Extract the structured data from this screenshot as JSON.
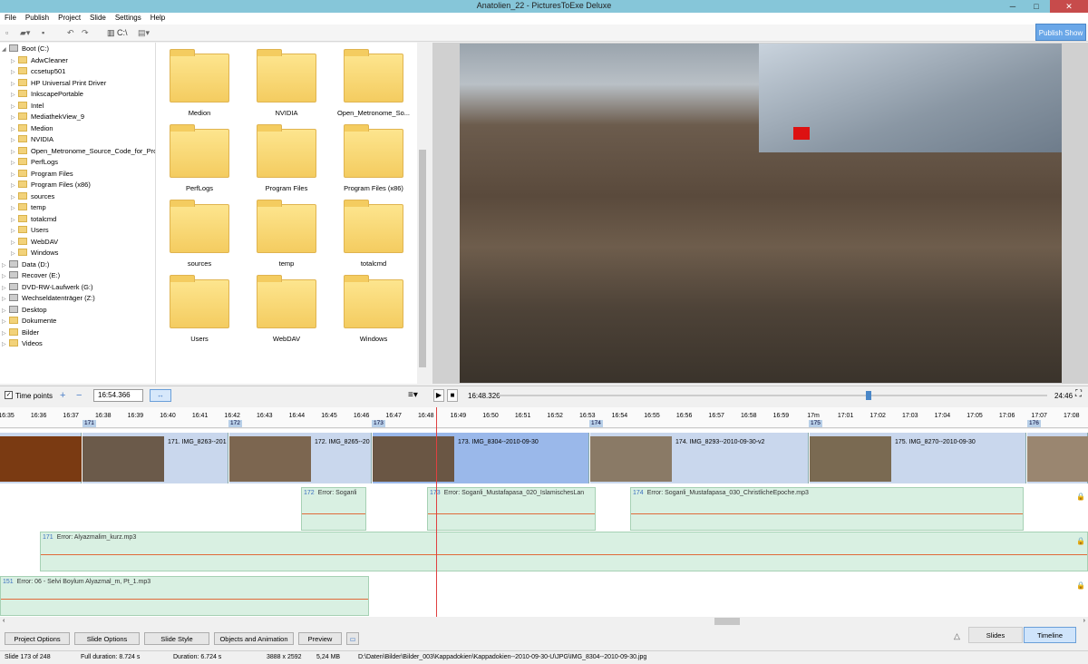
{
  "app": {
    "title": "Anatolien_22 - PicturesToExe Deluxe",
    "publish_label": "Publish Show"
  },
  "menu": [
    "File",
    "Publish",
    "Project",
    "Slide",
    "Settings",
    "Help"
  ],
  "toolbar": {
    "path_label": "C:\\"
  },
  "tree": [
    {
      "label": "Boot (C:)",
      "type": "drive",
      "level": 0
    },
    {
      "label": "AdwCleaner",
      "type": "folder",
      "level": 1
    },
    {
      "label": "ccsetup501",
      "type": "folder",
      "level": 1
    },
    {
      "label": "HP Universal Print Driver",
      "type": "folder",
      "level": 1
    },
    {
      "label": "InkscapePortable",
      "type": "folder",
      "level": 1
    },
    {
      "label": "Intel",
      "type": "folder",
      "level": 1
    },
    {
      "label": "MediathekView_9",
      "type": "folder",
      "level": 1
    },
    {
      "label": "Medion",
      "type": "folder",
      "level": 1
    },
    {
      "label": "NVIDIA",
      "type": "folder",
      "level": 1
    },
    {
      "label": "Open_Metronome_Source_Code_for_Prog",
      "type": "folder",
      "level": 1
    },
    {
      "label": "PerfLogs",
      "type": "folder",
      "level": 1
    },
    {
      "label": "Program Files",
      "type": "folder",
      "level": 1
    },
    {
      "label": "Program Files (x86)",
      "type": "folder",
      "level": 1
    },
    {
      "label": "sources",
      "type": "folder",
      "level": 1
    },
    {
      "label": "temp",
      "type": "folder",
      "level": 1
    },
    {
      "label": "totalcmd",
      "type": "folder",
      "level": 1
    },
    {
      "label": "Users",
      "type": "folder",
      "level": 1
    },
    {
      "label": "WebDAV",
      "type": "folder",
      "level": 1
    },
    {
      "label": "Windows",
      "type": "folder",
      "level": 1
    },
    {
      "label": "Data (D:)",
      "type": "drive",
      "level": 0
    },
    {
      "label": "Recover (E:)",
      "type": "drive",
      "level": 0
    },
    {
      "label": "DVD-RW-Laufwerk (G:)",
      "type": "drive",
      "level": 0
    },
    {
      "label": "Wechseldatenträger (Z:)",
      "type": "drive",
      "level": 0
    },
    {
      "label": "Desktop",
      "type": "drive",
      "level": 0
    },
    {
      "label": "Dokumente",
      "type": "folder",
      "level": 0
    },
    {
      "label": "Bilder",
      "type": "folder",
      "level": 0
    },
    {
      "label": "Videos",
      "type": "folder",
      "level": 0
    }
  ],
  "files": [
    "Medion",
    "NVIDIA",
    "Open_Metronome_So...",
    "PerfLogs",
    "Program Files",
    "Program Files (x86)",
    "sources",
    "temp",
    "totalcmd",
    "Users",
    "WebDAV",
    "Windows"
  ],
  "controls": {
    "time_points_label": "Time points",
    "time_value": "16:54.366",
    "play_time": "16:48.326",
    "end_time": "24:46"
  },
  "ruler": {
    "ticks": [
      "16:35",
      "16:36",
      "16:37",
      "16:38",
      "16:39",
      "16:40",
      "16:41",
      "16:42",
      "16:43",
      "16:44",
      "16:45",
      "16:46",
      "16:47",
      "16:48",
      "16:49",
      "16:50",
      "16:51",
      "16:52",
      "16:53",
      "16:54",
      "16:55",
      "16:56",
      "16:57",
      "16:58",
      "16:59",
      "17m",
      "17:01",
      "17:02",
      "17:03",
      "17:04",
      "17:05",
      "17:06",
      "17:07",
      "17:08"
    ],
    "slide_markers": [
      "171",
      "172",
      "173",
      "174",
      "175",
      "176"
    ]
  },
  "slides": [
    {
      "name": "",
      "color": "#7a3a12"
    },
    {
      "name": "171. IMG_8263--201",
      "color": "#6b5a4a"
    },
    {
      "name": "172. IMG_8265--20",
      "color": "#7c6650"
    },
    {
      "name": "173. IMG_8304--2010-09-30",
      "color": "#6a5644"
    },
    {
      "name": "174. IMG_8293--2010-09-30-v2",
      "color": "#8a7a66"
    },
    {
      "name": "175. IMG_8270--2010-09-30",
      "color": "#7a6a52"
    },
    {
      "name": "",
      "color": "#9a8670"
    }
  ],
  "audio": [
    {
      "num": "172",
      "label": "Error: Soganli"
    },
    {
      "num": "173",
      "label": "Error: Soganli_Mustafapasa_020_IslamischesLan"
    },
    {
      "num": "174",
      "label": "Error: Soganli_Mustafapasa_030_ChristlicheEpoche.mp3"
    },
    {
      "num": "171",
      "label": "Error: Alyazmalim_kurz.mp3"
    },
    {
      "num": "151",
      "label": "Error: 06 - Selvi Boylum Alyazmal_m, Pt_1.mp3"
    }
  ],
  "bottom": {
    "buttons": [
      "Project Options",
      "Slide Options",
      "Slide Style",
      "Objects and Animation",
      "Preview"
    ],
    "tabs": [
      "Slides",
      "Timeline"
    ]
  },
  "status": {
    "slide": "Slide 173 of 248",
    "full": "Full duration: 8.724 s",
    "duration": "Duration: 6.724 s",
    "dims": "3888 x 2592",
    "size": "5,24 MB",
    "path": "D:\\Daten\\Bilder\\Bilder_003\\Kappadokien\\Kappadokien--2010-09-30-U\\JPG\\IMG_8304--2010-09-30.jpg"
  },
  "colors": {
    "accent": "#6aa7e8",
    "titlebar": "#86c6d9"
  }
}
